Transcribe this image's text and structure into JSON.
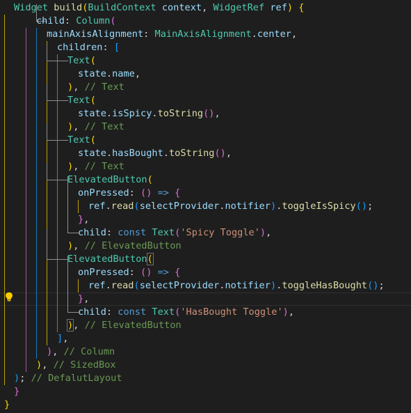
{
  "colors": {
    "background": "#1e1e1e",
    "keyword": "#569cd6",
    "function": "#dcdcaa",
    "type": "#4ec9b0",
    "variable": "#9cdcfe",
    "string": "#ce9178",
    "comment": "#6a9955",
    "bracket_gold": "#ffd700",
    "bracket_pink": "#da70d6",
    "bracket_blue": "#179fff",
    "text": "#d4d4d4",
    "lightbulb": "#ffcc00"
  },
  "code_lines": [
    [
      [
        "Widget ",
        "type"
      ],
      [
        "build",
        "function"
      ],
      [
        "(",
        "bracket_gold"
      ],
      [
        "BuildContext ",
        "type"
      ],
      [
        "context",
        "variable"
      ],
      [
        ", ",
        "text"
      ],
      [
        "WidgetRef ",
        "type"
      ],
      [
        "ref",
        "variable"
      ],
      [
        ") ",
        "bracket_gold"
      ],
      [
        "{",
        "bracket_gold"
      ]
    ],
    [
      [
        "child",
        "variable"
      ],
      [
        ": ",
        "text"
      ],
      [
        "Column",
        "type"
      ],
      [
        "(",
        "bracket_pink"
      ]
    ],
    [
      [
        "mainAxisAlignment",
        "variable"
      ],
      [
        ": ",
        "text"
      ],
      [
        "MainAxisAlignment",
        "type"
      ],
      [
        ".",
        "text"
      ],
      [
        "center",
        "variable"
      ],
      [
        ",",
        "text"
      ]
    ],
    [
      [
        "children",
        "variable"
      ],
      [
        ": ",
        "text"
      ],
      [
        "[",
        "bracket_blue"
      ]
    ],
    [
      [
        "Text",
        "type"
      ],
      [
        "(",
        "bracket_gold"
      ]
    ],
    [
      [
        "state",
        "variable"
      ],
      [
        ".",
        "text"
      ],
      [
        "name",
        "variable"
      ],
      [
        ",",
        "text"
      ]
    ],
    [
      [
        ")",
        "bracket_gold"
      ],
      [
        ", ",
        "text"
      ],
      [
        "// Text",
        "comment"
      ]
    ],
    [
      [
        "Text",
        "type"
      ],
      [
        "(",
        "bracket_gold"
      ]
    ],
    [
      [
        "state",
        "variable"
      ],
      [
        ".",
        "text"
      ],
      [
        "isSpicy",
        "variable"
      ],
      [
        ".",
        "text"
      ],
      [
        "toString",
        "function"
      ],
      [
        "()",
        "bracket_pink"
      ],
      [
        ",",
        "text"
      ]
    ],
    [
      [
        ")",
        "bracket_gold"
      ],
      [
        ", ",
        "text"
      ],
      [
        "// Text",
        "comment"
      ]
    ],
    [
      [
        "Text",
        "type"
      ],
      [
        "(",
        "bracket_gold"
      ]
    ],
    [
      [
        "state",
        "variable"
      ],
      [
        ".",
        "text"
      ],
      [
        "hasBought",
        "variable"
      ],
      [
        ".",
        "text"
      ],
      [
        "toString",
        "function"
      ],
      [
        "()",
        "bracket_pink"
      ],
      [
        ",",
        "text"
      ]
    ],
    [
      [
        ")",
        "bracket_gold"
      ],
      [
        ", ",
        "text"
      ],
      [
        "// Text",
        "comment"
      ]
    ],
    [
      [
        "ElevatedButton",
        "type"
      ],
      [
        "(",
        "bracket_gold"
      ]
    ],
    [
      [
        "onPressed",
        "variable"
      ],
      [
        ": ",
        "text"
      ],
      [
        "()",
        "bracket_pink"
      ],
      [
        " => ",
        "keyword"
      ],
      [
        "{",
        "bracket_pink"
      ]
    ],
    [
      [
        "ref",
        "variable"
      ],
      [
        ".",
        "text"
      ],
      [
        "read",
        "function"
      ],
      [
        "(",
        "bracket_blue"
      ],
      [
        "selectProvider",
        "variable"
      ],
      [
        ".",
        "text"
      ],
      [
        "notifier",
        "variable"
      ],
      [
        ")",
        "bracket_blue"
      ],
      [
        ".",
        "text"
      ],
      [
        "toggleIsSpicy",
        "function"
      ],
      [
        "()",
        "bracket_blue"
      ],
      [
        ";",
        "text"
      ]
    ],
    [
      [
        "}",
        "bracket_pink"
      ],
      [
        ",",
        "text"
      ]
    ],
    [
      [
        "child",
        "variable"
      ],
      [
        ": ",
        "text"
      ],
      [
        "const ",
        "keyword"
      ],
      [
        "Text",
        "type"
      ],
      [
        "(",
        "bracket_pink"
      ],
      [
        "'Spicy Toggle'",
        "string"
      ],
      [
        ")",
        "bracket_pink"
      ],
      [
        ",",
        "text"
      ]
    ],
    [
      [
        ")",
        "bracket_gold"
      ],
      [
        ", ",
        "text"
      ],
      [
        "// ElevatedButton",
        "comment"
      ]
    ],
    [
      [
        "ElevatedButton",
        "type"
      ],
      [
        "(",
        "bracket_gold"
      ]
    ],
    [
      [
        "onPressed",
        "variable"
      ],
      [
        ": ",
        "text"
      ],
      [
        "()",
        "bracket_pink"
      ],
      [
        " => ",
        "keyword"
      ],
      [
        "{",
        "bracket_pink"
      ]
    ],
    [
      [
        "ref",
        "variable"
      ],
      [
        ".",
        "text"
      ],
      [
        "read",
        "function"
      ],
      [
        "(",
        "bracket_blue"
      ],
      [
        "selectProvider",
        "variable"
      ],
      [
        ".",
        "text"
      ],
      [
        "notifier",
        "variable"
      ],
      [
        ")",
        "bracket_blue"
      ],
      [
        ".",
        "text"
      ],
      [
        "toggleHasBought",
        "function"
      ],
      [
        "()",
        "bracket_blue"
      ],
      [
        ";",
        "text"
      ]
    ],
    [
      [
        "}",
        "bracket_pink"
      ],
      [
        ",",
        "text"
      ]
    ],
    [
      [
        "child",
        "variable"
      ],
      [
        ": ",
        "text"
      ],
      [
        "const ",
        "keyword"
      ],
      [
        "Text",
        "type"
      ],
      [
        "(",
        "bracket_pink"
      ],
      [
        "'HasBought Toggle'",
        "string"
      ],
      [
        ")",
        "bracket_pink"
      ],
      [
        ",",
        "text"
      ]
    ],
    [
      [
        ")",
        "bracket_gold"
      ],
      [
        ", ",
        "text"
      ],
      [
        "// ElevatedButton",
        "comment"
      ]
    ],
    [
      [
        "]",
        "bracket_blue"
      ],
      [
        ",",
        "text"
      ]
    ],
    [
      [
        ")",
        "bracket_pink"
      ],
      [
        ", ",
        "text"
      ],
      [
        "// Column",
        "comment"
      ]
    ],
    [
      [
        ")",
        "bracket_gold"
      ],
      [
        ", ",
        "text"
      ],
      [
        "// SizedBox",
        "comment"
      ]
    ],
    [
      [
        ")",
        "bracket_blue"
      ],
      [
        "; ",
        "text"
      ],
      [
        "// DefalutLayout",
        "comment"
      ]
    ],
    [
      [
        "}",
        "bracket_pink"
      ]
    ],
    [
      [
        "}",
        "bracket_gold"
      ]
    ]
  ]
}
